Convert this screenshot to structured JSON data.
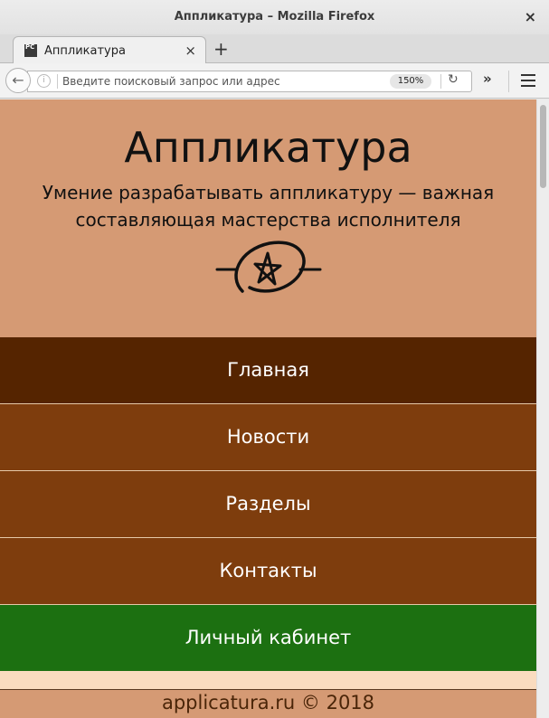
{
  "window": {
    "title": "Аппликатура – Mozilla Firefox",
    "close_glyph": "×"
  },
  "tabs": [
    {
      "label": "Аппликатура",
      "favicon_text": "PC",
      "close_glyph": "×"
    }
  ],
  "newtab_glyph": "+",
  "navbar": {
    "back_glyph": "←",
    "info_glyph": "i",
    "url_placeholder": "Введите поисковый запрос или адрес",
    "zoom": "150%",
    "reload_glyph": "↻",
    "overflow_glyph": "»"
  },
  "page": {
    "title": "Аппликатура",
    "subtitle": "Умение разрабатывать аппликатуру — важная составляющая мастерства исполнителя",
    "logo_icon": "pentagram-logo-icon",
    "nav": [
      {
        "label": "Главная",
        "state": "active"
      },
      {
        "label": "Новости",
        "state": "normal"
      },
      {
        "label": "Разделы",
        "state": "normal"
      },
      {
        "label": "Контакты",
        "state": "normal"
      },
      {
        "label": "Личный кабинет",
        "state": "cabinet"
      }
    ],
    "footer": "applicatura.ru © 2018"
  },
  "colors": {
    "header_bg": "#d59a74",
    "nav_active": "#552400",
    "nav_normal": "#7e3d0d",
    "nav_cabinet": "#1c7011",
    "page_bg": "#fadcbf"
  }
}
